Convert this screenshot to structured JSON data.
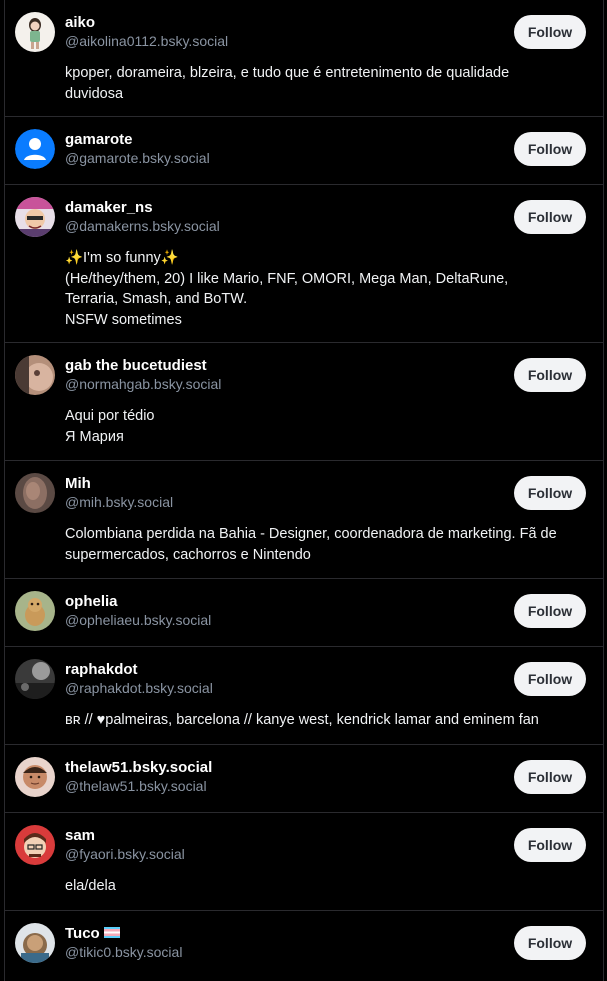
{
  "follow_label": "Follow",
  "accounts": [
    {
      "display_name": "aiko",
      "handle": "@aikolina0112.bsky.social",
      "bio_lines": [
        "kpoper, dorameira, blzeira, e tudo que é entretenimento de qualidade",
        "duvidosa"
      ],
      "avatar_icon": "anime-character-avatar"
    },
    {
      "display_name": "gamarote",
      "handle": "@gamarote.bsky.social",
      "bio_lines": [],
      "avatar_icon": "default-user-avatar"
    },
    {
      "display_name": "damaker_ns",
      "handle": "@damakerns.bsky.social",
      "bio_lines": [
        "✨I'm so funny✨",
        "(He/they/them, 20) I like Mario, FNF, OMORI, Mega Man, DeltaRune,",
        "Terraria, Smash, and BoTW.",
        "NSFW sometimes"
      ],
      "avatar_icon": "cartoon-avatar"
    },
    {
      "display_name": "gab the bucetudiest",
      "handle": "@normahgab.bsky.social",
      "bio_lines": [
        "Aqui por tédio",
        "Я Мария"
      ],
      "avatar_icon": "photo-avatar"
    },
    {
      "display_name": "Mih",
      "handle": "@mih.bsky.social",
      "bio_lines": [
        "Colombiana perdida na Bahia - Designer, coordenadora de marketing. Fã de",
        "supermercados, cachorros e Nintendo"
      ],
      "avatar_icon": "blurred-photo-avatar"
    },
    {
      "display_name": "ophelia",
      "handle": "@opheliaeu.bsky.social",
      "bio_lines": [],
      "avatar_icon": "animal-avatar"
    },
    {
      "display_name": "raphakdot",
      "handle": "@raphakdot.bsky.social",
      "bio_lines": [
        "ʙʀ // ♥palmeiras, barcelona // kanye west, kendrick lamar and eminem fan"
      ],
      "avatar_icon": "grayscale-photo-avatar"
    },
    {
      "display_name": "thelaw51.bsky.social",
      "handle": "@thelaw51.bsky.social",
      "bio_lines": [],
      "avatar_icon": "illustrated-face-avatar"
    },
    {
      "display_name": "sam",
      "handle": "@fyaori.bsky.social",
      "bio_lines": [
        "ela/dela"
      ],
      "avatar_icon": "red-cartoon-avatar"
    },
    {
      "display_name": "Tuco",
      "handle": "@tikic0.bsky.social",
      "bio_lines": [],
      "avatar_icon": "character-avatar",
      "badge_icon": "trans-flag-icon"
    }
  ]
}
